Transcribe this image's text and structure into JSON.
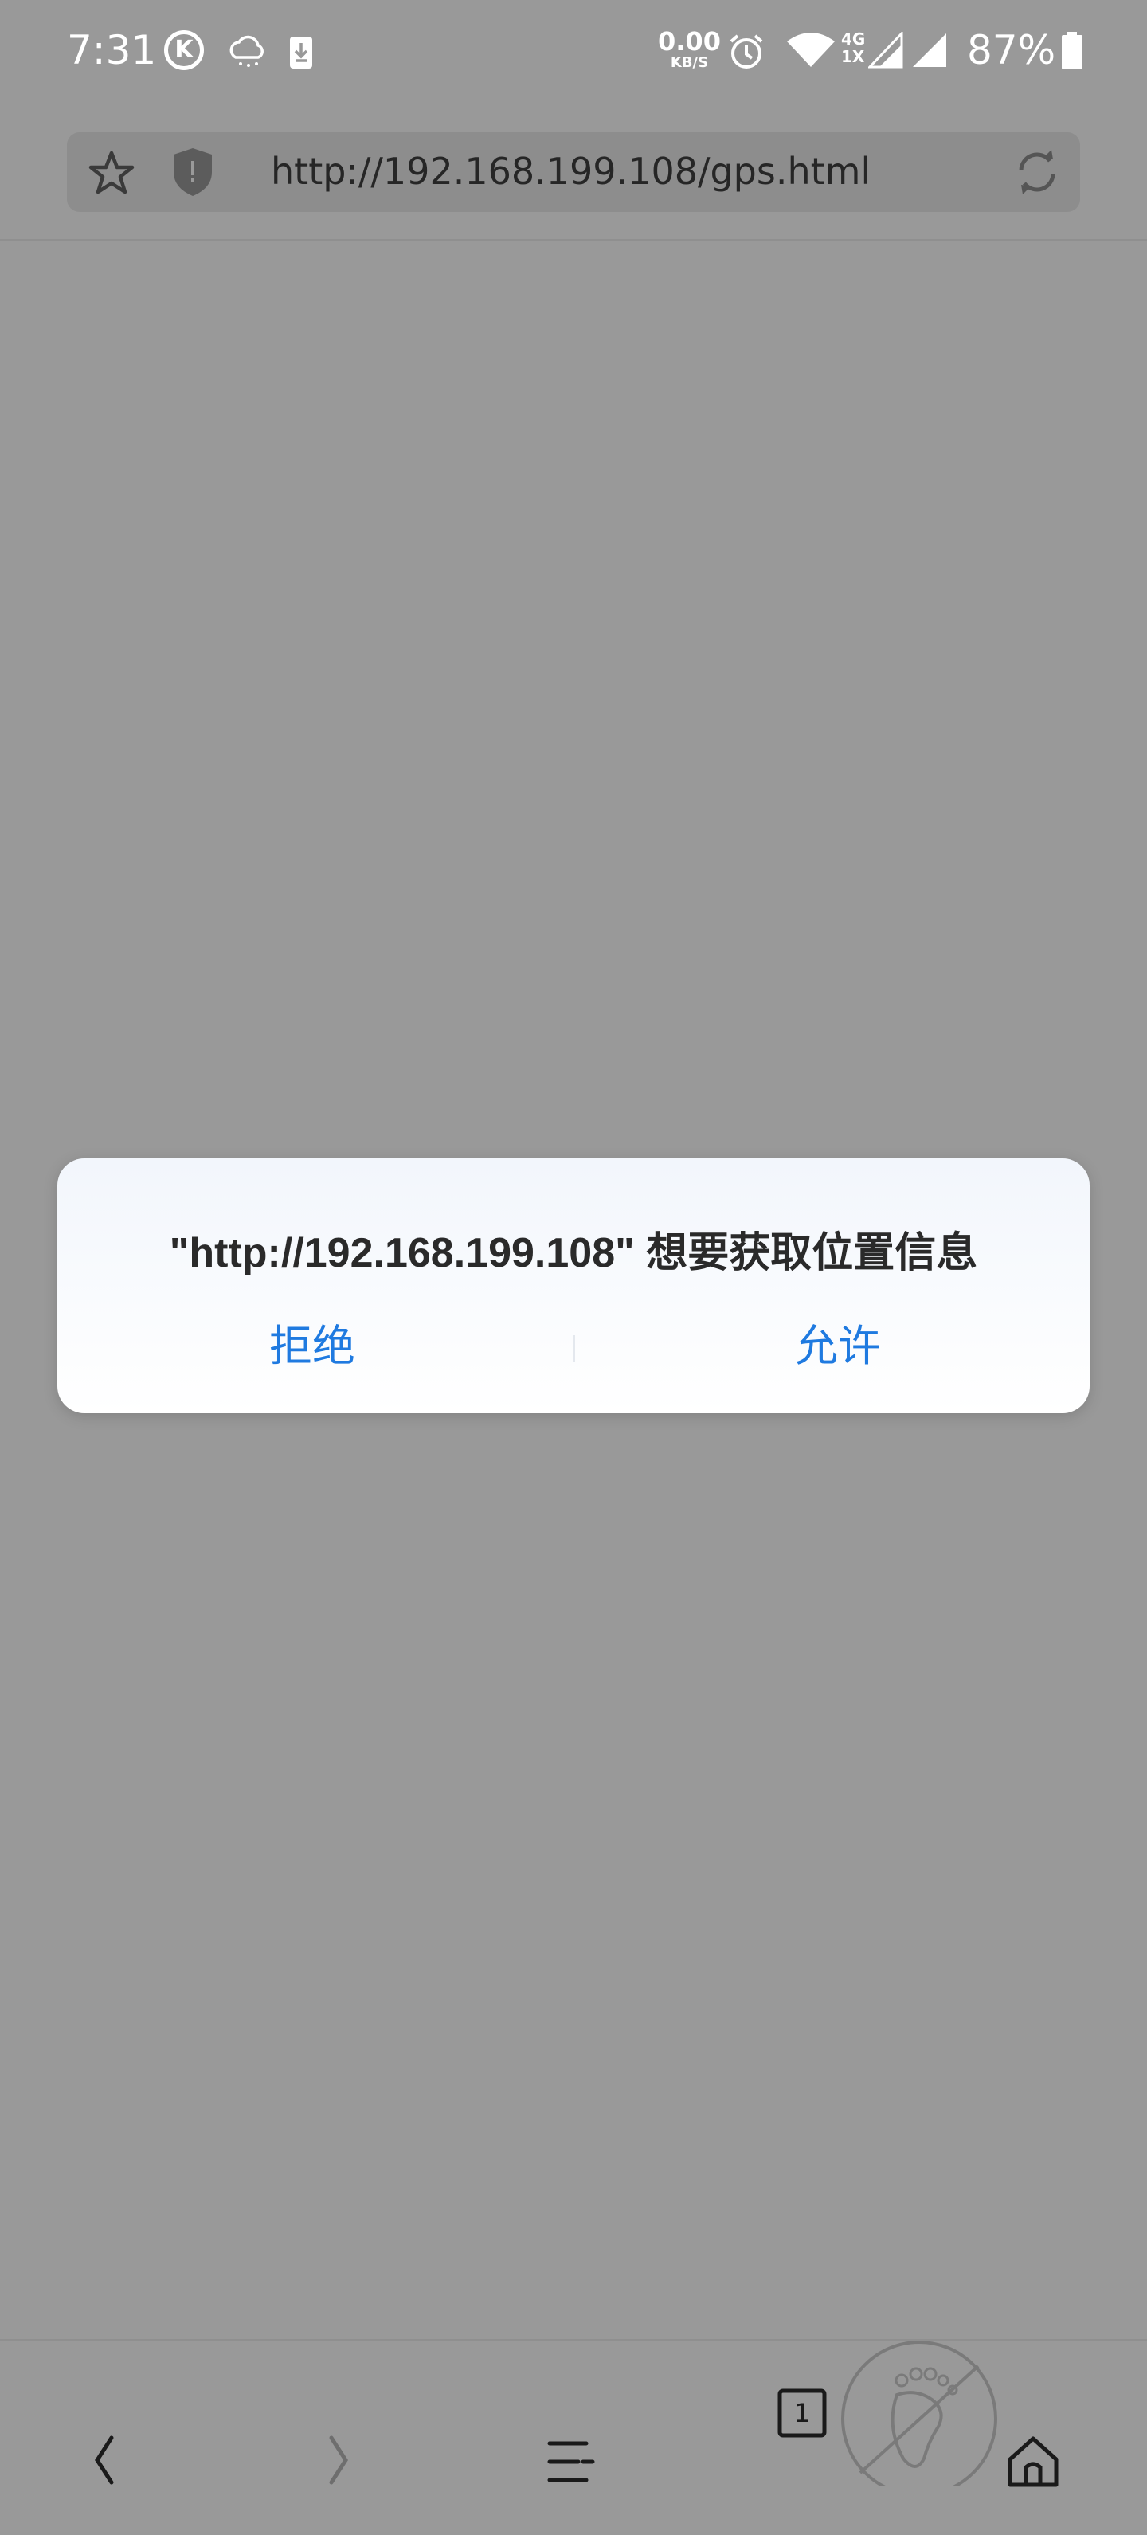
{
  "status_bar": {
    "time": "7:31",
    "k_icon_letter": "K",
    "network_speed_value": "0.00",
    "network_speed_unit": "KB/S",
    "network_type_top": "4G",
    "network_type_bottom": "1X",
    "battery_percent": "87%"
  },
  "url_bar": {
    "url": "http://192.168.199.108/gps.html"
  },
  "dialog": {
    "message": "\"http://192.168.199.108\" 想要获取位置信息",
    "deny_label": "拒绝",
    "allow_label": "允许",
    "button_color": "#1f7ae0"
  },
  "bottom_bar": {
    "tab_count": "1"
  },
  "colors": {
    "overlay_background": "#999999",
    "dialog_background": "#ffffff",
    "accent": "#1f7ae0"
  }
}
